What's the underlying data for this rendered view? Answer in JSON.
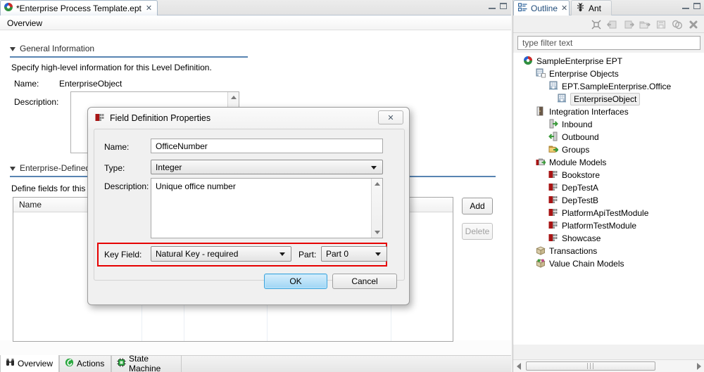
{
  "editor": {
    "tab": {
      "title": "*Enterprise Process Template.ept",
      "close": "✕",
      "icon": "ept-file-icon"
    },
    "breadcrumb": "Overview",
    "sections": {
      "general": {
        "header": "General Information",
        "description_text": "Specify high-level information for this Level Definition.",
        "name_label": "Name:",
        "name_value": "EnterpriseObject",
        "description_label": "Description:",
        "description_value": ""
      },
      "enterprise_defined": {
        "header": "Enterprise-Defined",
        "intro": "Define fields for this"
      }
    },
    "fields_table": {
      "columns": [
        "Name"
      ],
      "rows": []
    },
    "buttons": {
      "add": "Add",
      "delete": "Delete"
    },
    "page_tabs": [
      {
        "label": "Overview",
        "icon": "binoculars-icon",
        "active": true
      },
      {
        "label": "Actions",
        "icon": "action-icon",
        "active": false
      },
      {
        "label": "State Machine",
        "icon": "chip-icon",
        "active": false
      }
    ]
  },
  "dialog": {
    "title": "Field Definition Properties",
    "icon": "module-icon",
    "close": "✕",
    "fields": {
      "name_label": "Name:",
      "name_value": "OfficeNumber",
      "type_label": "Type:",
      "type_value": "Integer",
      "description_label": "Description:",
      "description_value": "Unique office number",
      "key_field_label": "Key Field:",
      "key_field_value": "Natural Key - required",
      "part_label": "Part:",
      "part_value": "Part 0"
    },
    "buttons": {
      "ok": "OK",
      "cancel": "Cancel"
    },
    "highlight_color": "#e60000"
  },
  "outline": {
    "tabs": [
      {
        "label": "Outline",
        "icon": "outline-icon",
        "close": "✕",
        "active": true
      },
      {
        "label": "Ant",
        "icon": "ant-icon",
        "active": false
      }
    ],
    "toolbar_icons": [
      "collapse-all-icon",
      "link-editor-back-icon",
      "link-editor-forward-icon",
      "open-view-icon",
      "export-icon",
      "filter-icon",
      "close-view-icon"
    ],
    "filter_placeholder": "type filter text",
    "tree": [
      {
        "label": "SampleEnterprise EPT",
        "depth": 0,
        "icon": "ept-root-icon",
        "selected": false
      },
      {
        "label": "Enterprise Objects",
        "depth": 1,
        "icon": "enterprise-objects-icon",
        "selected": false
      },
      {
        "label": "EPT.SampleEnterprise.Office",
        "depth": 2,
        "icon": "enterprise-object-icon",
        "selected": false
      },
      {
        "label": "EnterpriseObject",
        "depth": 3,
        "icon": "enterprise-object-icon",
        "selected": true
      },
      {
        "label": "Integration Interfaces",
        "depth": 1,
        "icon": "integration-interfaces-icon",
        "selected": false
      },
      {
        "label": "Inbound",
        "depth": 2,
        "icon": "inbound-icon",
        "selected": false
      },
      {
        "label": "Outbound",
        "depth": 2,
        "icon": "outbound-icon",
        "selected": false
      },
      {
        "label": "Groups",
        "depth": 2,
        "icon": "groups-folder-icon",
        "selected": false
      },
      {
        "label": "Module Models",
        "depth": 1,
        "icon": "module-models-icon",
        "selected": false
      },
      {
        "label": "Bookstore",
        "depth": 2,
        "icon": "module-icon",
        "selected": false
      },
      {
        "label": "DepTestA",
        "depth": 2,
        "icon": "module-icon",
        "selected": false
      },
      {
        "label": "DepTestB",
        "depth": 2,
        "icon": "module-icon",
        "selected": false
      },
      {
        "label": "PlatformApiTestModule",
        "depth": 2,
        "icon": "module-icon",
        "selected": false
      },
      {
        "label": "PlatformTestModule",
        "depth": 2,
        "icon": "module-icon",
        "selected": false
      },
      {
        "label": "Showcase",
        "depth": 2,
        "icon": "module-icon",
        "selected": false
      },
      {
        "label": "Transactions",
        "depth": 1,
        "icon": "transactions-icon",
        "selected": false
      },
      {
        "label": "Value Chain Models",
        "depth": 1,
        "icon": "value-chain-icon",
        "selected": false
      }
    ]
  },
  "colors": {
    "section_rule": "#3b6ea5",
    "selection": "#f0f0f0",
    "highlight": "#e60000",
    "tab_text_active": "#1f4b7a"
  }
}
